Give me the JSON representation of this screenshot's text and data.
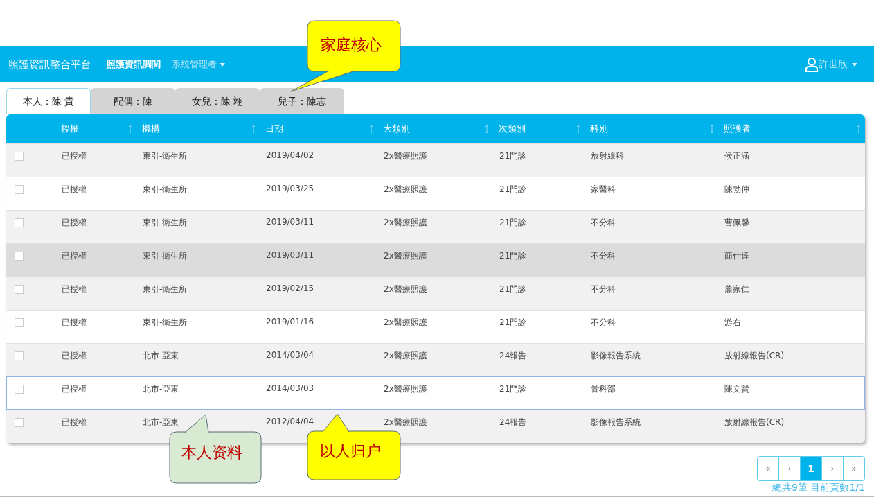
{
  "navbar": {
    "brand": "照護資訊整合平台",
    "items": [
      {
        "label": "照護資訊調閱",
        "kind": "link"
      },
      {
        "label": "系統管理者",
        "kind": "dropdown"
      }
    ],
    "user": "許世欣"
  },
  "tabs": [
    {
      "label": "本人：陳 貴",
      "selected": true
    },
    {
      "label": "配偶：陳",
      "selected": false
    },
    {
      "label": "女兒：陳 翊",
      "selected": false
    },
    {
      "label": "兒子：陳志",
      "selected": false
    }
  ],
  "table": {
    "columns": [
      "授權",
      "機構",
      "日期",
      "大類別",
      "次類別",
      "科別",
      "照護者"
    ],
    "rows": [
      {
        "checked": false,
        "selected": false,
        "hovered": false,
        "cells": [
          "已授權",
          "東引-衛生所",
          "2019/04/02",
          "2x醫療照護",
          "21門診",
          "放射線科",
          "侯正涵"
        ]
      },
      {
        "checked": false,
        "selected": false,
        "hovered": false,
        "cells": [
          "已授權",
          "東引-衛生所",
          "2019/03/25",
          "2x醫療照護",
          "21門診",
          "家醫科",
          "陳勃仲"
        ]
      },
      {
        "checked": false,
        "selected": false,
        "hovered": false,
        "cells": [
          "已授權",
          "東引-衛生所",
          "2019/03/11",
          "2x醫療照護",
          "21門診",
          "不分科",
          "曹佩馨"
        ]
      },
      {
        "checked": false,
        "selected": false,
        "hovered": true,
        "cells": [
          "已授權",
          "東引-衛生所",
          "2019/03/11",
          "2x醫療照護",
          "21門診",
          "不分科",
          "商仕達"
        ]
      },
      {
        "checked": false,
        "selected": false,
        "hovered": false,
        "cells": [
          "已授權",
          "東引-衛生所",
          "2019/02/15",
          "2x醫療照護",
          "21門診",
          "不分科",
          "蕭家仁"
        ]
      },
      {
        "checked": false,
        "selected": false,
        "hovered": false,
        "cells": [
          "已授權",
          "東引-衛生所",
          "2019/01/16",
          "2x醫療照護",
          "21門診",
          "不分科",
          "游右一"
        ]
      },
      {
        "checked": false,
        "selected": false,
        "hovered": false,
        "cells": [
          "已授權",
          "北市-亞東",
          "2014/03/04",
          "2x醫療照護",
          "24報告",
          "影像報告系統",
          "放射線報告(CR)"
        ]
      },
      {
        "checked": false,
        "selected": true,
        "hovered": false,
        "cells": [
          "已授權",
          "北市-亞東",
          "2014/03/03",
          "2x醫療照護",
          "21門診",
          "骨科部",
          "陳文賢"
        ]
      },
      {
        "checked": false,
        "selected": false,
        "hovered": false,
        "cells": [
          "已授權",
          "北市-亞東",
          "2012/04/04",
          "2x醫療照護",
          "24報告",
          "影像報告系統",
          "放射線報告(CR)"
        ]
      }
    ]
  },
  "pagination": {
    "pages": [
      {
        "label": "«",
        "selected": false
      },
      {
        "label": "‹",
        "selected": false
      },
      {
        "label": "1",
        "selected": true
      },
      {
        "label": "›",
        "selected": false
      },
      {
        "label": "»",
        "selected": false
      }
    ],
    "summary": "總共9筆 目前頁數1/1"
  },
  "callouts": [
    {
      "text": "家庭核心",
      "color": "#ffff00"
    },
    {
      "text": "以人归户",
      "color": "#ffff00"
    },
    {
      "text": "本人资料",
      "color": "#d9ead3"
    }
  ]
}
